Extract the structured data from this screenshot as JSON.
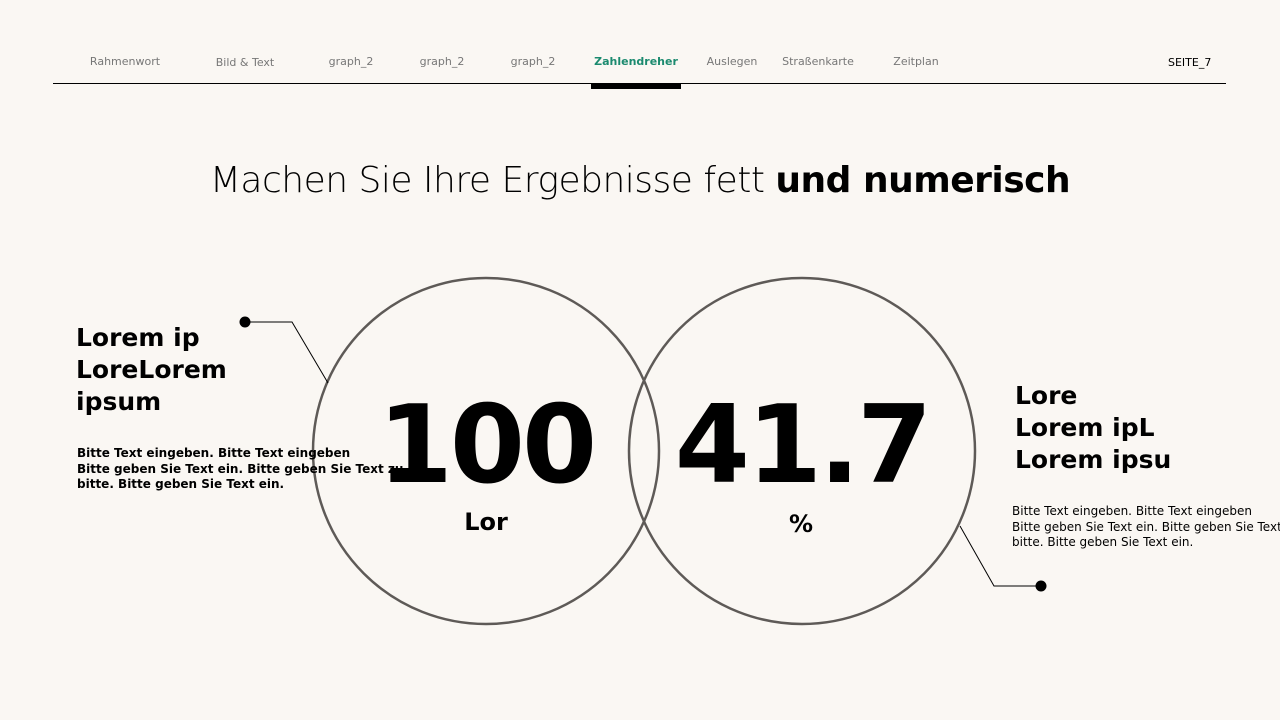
{
  "nav": {
    "items": [
      {
        "label": "Rahmenwort"
      },
      {
        "label": "Bild & Text"
      },
      {
        "label": "graph_2"
      },
      {
        "label": "graph_2"
      },
      {
        "label": "graph_2"
      },
      {
        "label": "Zahlendreher"
      },
      {
        "label": "Auslegen"
      },
      {
        "label": "Straßenkarte"
      },
      {
        "label": "Zeitplan"
      }
    ],
    "active_index": 5,
    "page_label": "SEITE_7"
  },
  "title": {
    "light": "Machen Sie Ihre Ergebnisse fett ",
    "bold": "und numerisch"
  },
  "left": {
    "heading": "Lorem ip\nLoreLorem\nipsum",
    "body": "Bitte Text eingeben. Bitte Text eingeben\nBitte geben Sie Text ein. Bitte geben Sie Text zu\nbitte. Bitte geben Sie Text ein.",
    "number": "100",
    "unit": "Lor"
  },
  "right": {
    "heading": "Lore\nLorem ipL\nLorem ipsu",
    "body": "Bitte Text eingeben. Bitte Text eingeben\nBitte geben Sie Text ein. Bitte geben Sie Text zu\nbitte. Bitte geben Sie Text ein.",
    "number": "41.7",
    "unit": "%"
  },
  "colors": {
    "background": "#faf7f3",
    "accent": "#1b8a6f",
    "circle_stroke": "#5e5a57"
  }
}
